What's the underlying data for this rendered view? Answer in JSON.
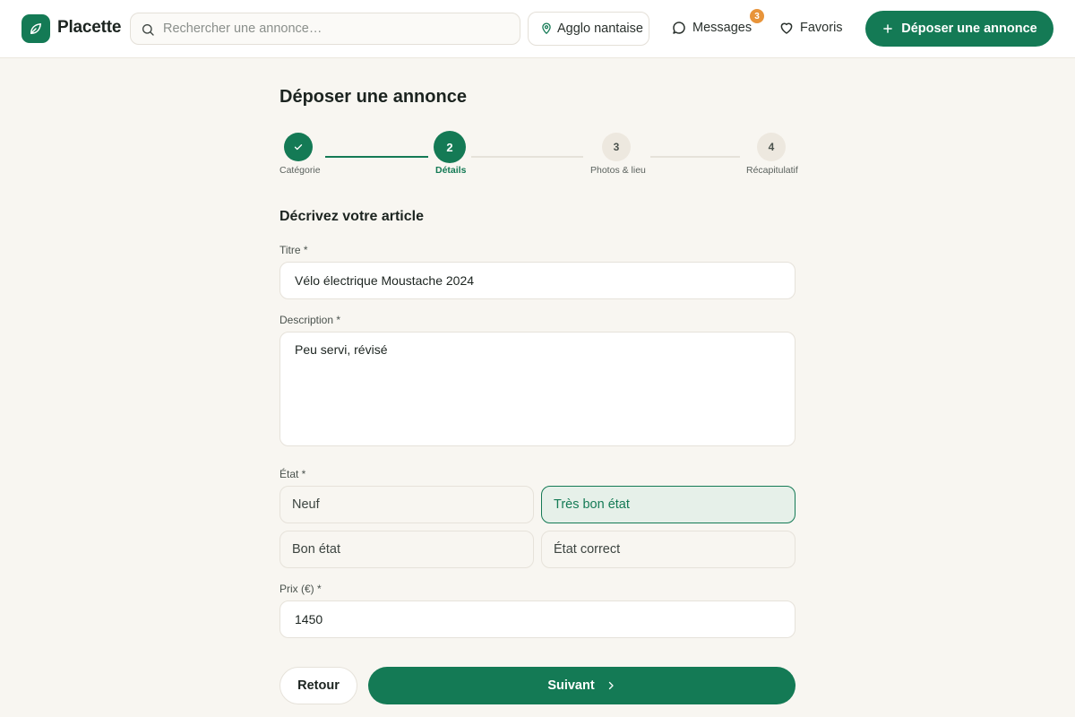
{
  "header": {
    "brand": "Placette",
    "search_placeholder": "Rechercher une annonce…",
    "location": "Agglo nantaise",
    "messages_label": "Messages",
    "messages_count": "3",
    "favorites_label": "Favoris",
    "cta_label": "Déposer une annonce"
  },
  "page": {
    "title": "Déposer une annonce",
    "section_title": "Décrivez votre article"
  },
  "steps": [
    {
      "number": "1",
      "label": "Catégorie",
      "status": "done"
    },
    {
      "number": "2",
      "label": "Détails",
      "status": "current"
    },
    {
      "number": "3",
      "label": "Photos & lieu",
      "status": "todo"
    },
    {
      "number": "4",
      "label": "Récapitulatif",
      "status": "todo"
    }
  ],
  "form": {
    "title_label": "Titre *",
    "title_value": "Vélo électrique Moustache 2024",
    "description_label": "Description *",
    "description_value": "Peu servi, révisé",
    "condition_label": "État *",
    "conditions": [
      {
        "label": "Neuf",
        "selected": false
      },
      {
        "label": "Très bon état",
        "selected": true
      },
      {
        "label": "Bon état",
        "selected": false
      },
      {
        "label": "État correct",
        "selected": false
      }
    ],
    "price_label": "Prix (€) *",
    "price_value": "1450"
  },
  "actions": {
    "back_label": "Retour",
    "next_label": "Suivant"
  },
  "colors": {
    "brand": "#147a55",
    "badge": "#e8943a",
    "background": "#f8f6f1",
    "selected_bg": "#e6f0e9"
  }
}
